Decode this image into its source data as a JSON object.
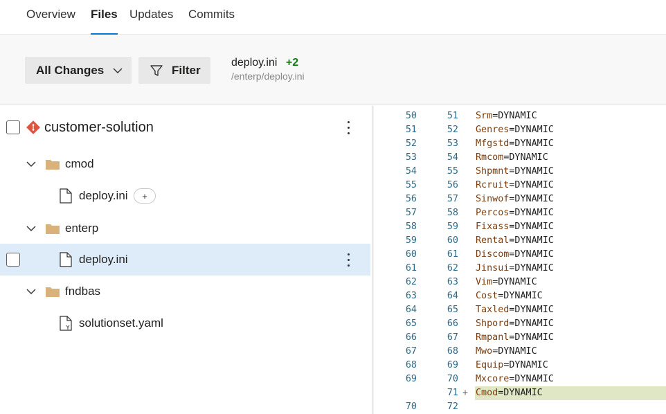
{
  "tabs": [
    "Overview",
    "Files",
    "Updates",
    "Commits"
  ],
  "active_tab": "Files",
  "toolbar": {
    "all_changes_label": "All Changes",
    "filter_label": "Filter",
    "file_name": "deploy.ini",
    "file_change_count": "+2",
    "file_path": "/enterp/deploy.ini"
  },
  "tree": {
    "repo": "customer-solution",
    "folders": [
      {
        "name": "cmod",
        "files": [
          {
            "name": "deploy.ini",
            "badge": "+"
          }
        ]
      },
      {
        "name": "enterp",
        "files": [
          {
            "name": "deploy.ini"
          }
        ]
      },
      {
        "name": "fndbas",
        "files": [
          {
            "name": "solutionset.yaml"
          }
        ]
      }
    ]
  },
  "diff": {
    "lines": [
      {
        "old": "50",
        "new": "51",
        "key": "Srm",
        "val": "=DYNAMIC"
      },
      {
        "old": "51",
        "new": "52",
        "key": "Genres",
        "val": "=DYNAMIC"
      },
      {
        "old": "52",
        "new": "53",
        "key": "Mfgstd",
        "val": "=DYNAMIC"
      },
      {
        "old": "53",
        "new": "54",
        "key": "Rmcom",
        "val": "=DYNAMIC"
      },
      {
        "old": "54",
        "new": "55",
        "key": "Shpmnt",
        "val": "=DYNAMIC"
      },
      {
        "old": "55",
        "new": "56",
        "key": "Rcruit",
        "val": "=DYNAMIC"
      },
      {
        "old": "56",
        "new": "57",
        "key": "Sinwof",
        "val": "=DYNAMIC"
      },
      {
        "old": "57",
        "new": "58",
        "key": "Percos",
        "val": "=DYNAMIC"
      },
      {
        "old": "58",
        "new": "59",
        "key": "Fixass",
        "val": "=DYNAMIC"
      },
      {
        "old": "59",
        "new": "60",
        "key": "Rental",
        "val": "=DYNAMIC"
      },
      {
        "old": "60",
        "new": "61",
        "key": "Discom",
        "val": "=DYNAMIC"
      },
      {
        "old": "61",
        "new": "62",
        "key": "Jinsui",
        "val": "=DYNAMIC"
      },
      {
        "old": "62",
        "new": "63",
        "key": "Vim",
        "val": "=DYNAMIC"
      },
      {
        "old": "63",
        "new": "64",
        "key": "Cost",
        "val": "=DYNAMIC"
      },
      {
        "old": "64",
        "new": "65",
        "key": "Taxled",
        "val": "=DYNAMIC"
      },
      {
        "old": "65",
        "new": "66",
        "key": "Shpord",
        "val": "=DYNAMIC"
      },
      {
        "old": "66",
        "new": "67",
        "key": "Rmpanl",
        "val": "=DYNAMIC"
      },
      {
        "old": "67",
        "new": "68",
        "key": "Mwo",
        "val": "=DYNAMIC"
      },
      {
        "old": "68",
        "new": "69",
        "key": "Equip",
        "val": "=DYNAMIC"
      },
      {
        "old": "69",
        "new": "70",
        "key": "Mxcore",
        "val": "=DYNAMIC"
      },
      {
        "old": "",
        "new": "71",
        "marker": "+",
        "key": "Cmod",
        "val": "=DYNAMIC",
        "added": true
      },
      {
        "old": "70",
        "new": "72",
        "key": "",
        "val": ""
      }
    ]
  },
  "colors": {
    "accent": "#0078d4",
    "added_count": "#107c10",
    "added_line_bg": "#dfe7c4",
    "selected_row_bg": "#deecf9",
    "folder": "#d8b27a",
    "repo_icon": "#e0533d"
  }
}
